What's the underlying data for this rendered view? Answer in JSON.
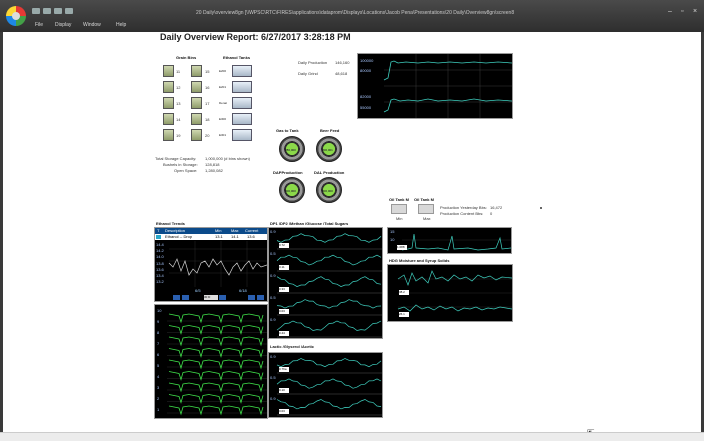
{
  "window": {
    "title": "20  Daily\\overview8gn   [\\\\WPSC\\RTC\\FIRES\\applications\\dataprom\\Displays\\Locations\\Jacob Pena\\Presentations\\20  Daily\\Overview8gn\\screen8",
    "menu": [
      "File",
      "Display",
      "Window",
      "Help"
    ]
  },
  "report": {
    "title": "Daily Overview Report:  6/27/2017 3:28:18 PM"
  },
  "grain_bins": {
    "title": "Grain Bins",
    "bins": [
      "11",
      "15",
      "12",
      "16",
      "13",
      "17",
      "14",
      "18",
      "19",
      "20"
    ]
  },
  "ethanol_tanks": {
    "title": "Ethanol Tanks",
    "tanks": [
      "E200",
      "E201",
      "Denat",
      "E300",
      "E301"
    ]
  },
  "storage": {
    "capacity_label": "Total Storage Capacity:",
    "capacity_value": "1,000,000 (# bins shown)",
    "in_storage_label": "Bushels in Storage:",
    "in_storage_value": "128,818",
    "open_label": "Open Space:",
    "open_value": "1,280,082"
  },
  "daily": {
    "production_label": "Daily Production",
    "production_value": "146,160",
    "grind_label": "Daily Grind",
    "grind_value": "48,618"
  },
  "top_trend": {
    "ticks_top": [
      "100000",
      "80000"
    ],
    "ticks_bottom": [
      "82000",
      "55000"
    ]
  },
  "gauges": [
    {
      "label": "Gas to Tank",
      "value": "280,000"
    },
    {
      "label": "Beer Feed",
      "value": "200,001"
    },
    {
      "label": "DAPProduction",
      "value": "000,000"
    },
    {
      "label": "DAL Production",
      "value": "000,000"
    }
  ],
  "oil_tanks": {
    "tank_a_label": "Oil Tank M",
    "tank_a_sub": "Min",
    "tank_b_label": "Oil Tank M",
    "tank_b_sub": "Max",
    "prod_label": "Production Yesterday Bbs:",
    "prod_value": "16,472",
    "content_label": "Production Content Bbs:",
    "content_value": "0"
  },
  "ethanol_trends": {
    "title": "Ethanol Trends",
    "columns": [
      "T",
      "Description",
      "Min",
      "Max",
      "Current"
    ],
    "row": [
      "",
      "Ethanol -- Drop",
      "13.1",
      "14.1",
      "13.6"
    ],
    "yticks": [
      "14.4",
      "14.2",
      "14.0",
      "13.8",
      "13.6",
      "13.4",
      "13.2"
    ],
    "xticks": [
      "6/5",
      "6/18"
    ],
    "ctrl_value": "30 D"
  },
  "dp_chart": {
    "title": "DP1 /DP2 /Methan /Glucose /Total Sugars",
    "values": [
      "0.72",
      "0.11",
      "0.33",
      "0.03",
      "0.44"
    ]
  },
  "lactic_chart": {
    "title": "Lactic /Glyserol /Acetic",
    "values": [
      "0.76a",
      "0.10",
      "0.03"
    ]
  },
  "right_trend_top": {
    "ticks": [
      "15",
      "10"
    ],
    "value": "1.088"
  },
  "hdg_chart": {
    "title": "HDG Moisture and Syrup Solids",
    "values": [
      "38.2",
      "26.1"
    ]
  },
  "pins_chart": {
    "yticks": [
      "10",
      "9",
      "8",
      "7",
      "6",
      "5",
      "4",
      "3",
      "2",
      "1"
    ]
  }
}
